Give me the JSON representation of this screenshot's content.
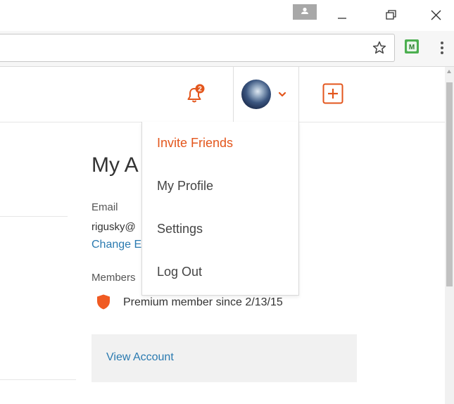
{
  "colors": {
    "accent_orange": "#e3561c",
    "link_blue": "#2a7ab0",
    "extension_green": "#4caf50"
  },
  "window_controls": {
    "profile_icon": "person-icon",
    "minimize_icon": "minimize-icon",
    "restore_icon": "restore-icon",
    "close_icon": "close-icon"
  },
  "browser": {
    "bookmark_icon": "star-icon",
    "extension_icon": "extension-icon",
    "extension_letter": "M",
    "menu_icon": "more-vert-icon"
  },
  "header": {
    "notification_count": "2",
    "notification_icon": "bell-icon",
    "avatar_caret_icon": "chevron-down-icon",
    "create_icon": "plus-box-icon"
  },
  "dropdown": {
    "items": [
      {
        "label": "Invite Friends"
      },
      {
        "label": "My Profile"
      },
      {
        "label": "Settings"
      },
      {
        "label": "Log Out"
      }
    ]
  },
  "account": {
    "title": "My A",
    "email_label": "Email",
    "email_value": "rigusky@",
    "change_email_link": "Change E",
    "membership_label": "Members",
    "membership_icon": "shield-icon",
    "premium_text": "Premium member since 2/13/15",
    "view_account_link": "View Account"
  }
}
